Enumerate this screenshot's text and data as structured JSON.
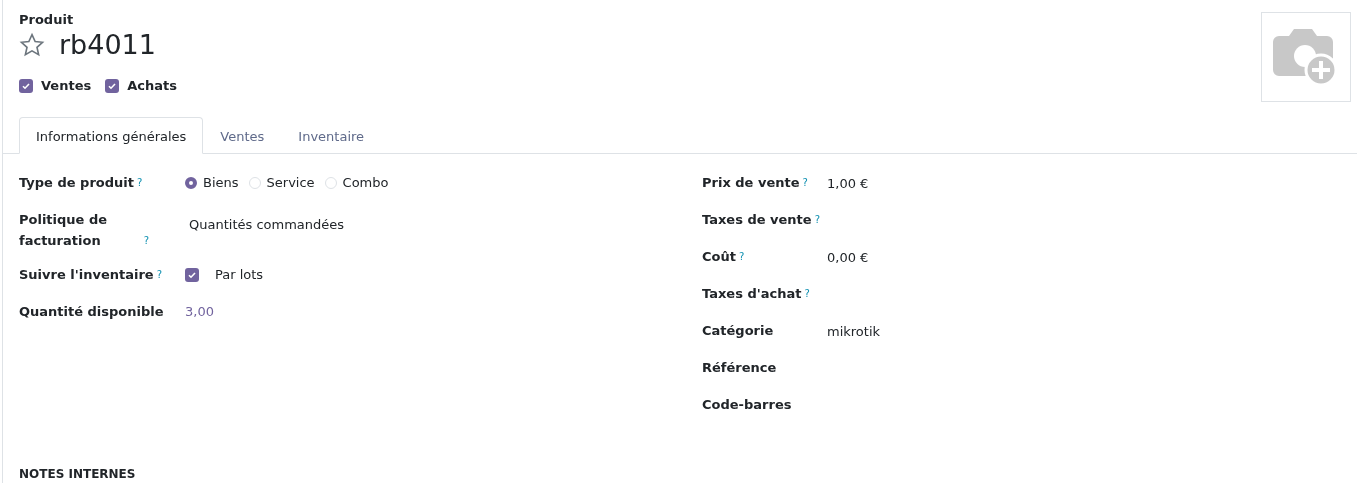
{
  "header": {
    "label": "Produit",
    "name": "rb4011",
    "favorite": false
  },
  "flags": [
    {
      "label": "Ventes",
      "checked": true
    },
    {
      "label": "Achats",
      "checked": true
    }
  ],
  "tabs": [
    {
      "label": "Informations générales",
      "selected": true
    },
    {
      "label": "Ventes",
      "selected": false
    },
    {
      "label": "Inventaire",
      "selected": false
    }
  ],
  "left_fields": [
    {
      "label": "Type de produit",
      "help": "?",
      "kind": "radio",
      "options": [
        {
          "label": "Biens",
          "selected": true
        },
        {
          "label": "Service",
          "selected": false
        },
        {
          "label": "Combo",
          "selected": false
        }
      ]
    },
    {
      "label": "Politique de facturation",
      "help": "?",
      "kind": "text",
      "value": "Quantités commandées"
    },
    {
      "label": "Suivre l'inventaire",
      "help": "?",
      "kind": "checkbox",
      "checked": true,
      "value": "Par lots"
    },
    {
      "label": "Quantité disponible",
      "kind": "link",
      "value": "3,00"
    }
  ],
  "right_fields": [
    {
      "label": "Prix de vente",
      "help": "?",
      "value": "1,00 €"
    },
    {
      "label": "Taxes de vente",
      "help": "?"
    },
    {
      "label": "Coût",
      "help": "?",
      "value": "0,00 €"
    },
    {
      "label": "Taxes d'achat",
      "help": "?"
    },
    {
      "label": "Catégorie",
      "value": "mikrotik"
    },
    {
      "label": "Référence"
    },
    {
      "label": "Code-barres"
    }
  ],
  "section_title": "NOTES INTERNES"
}
